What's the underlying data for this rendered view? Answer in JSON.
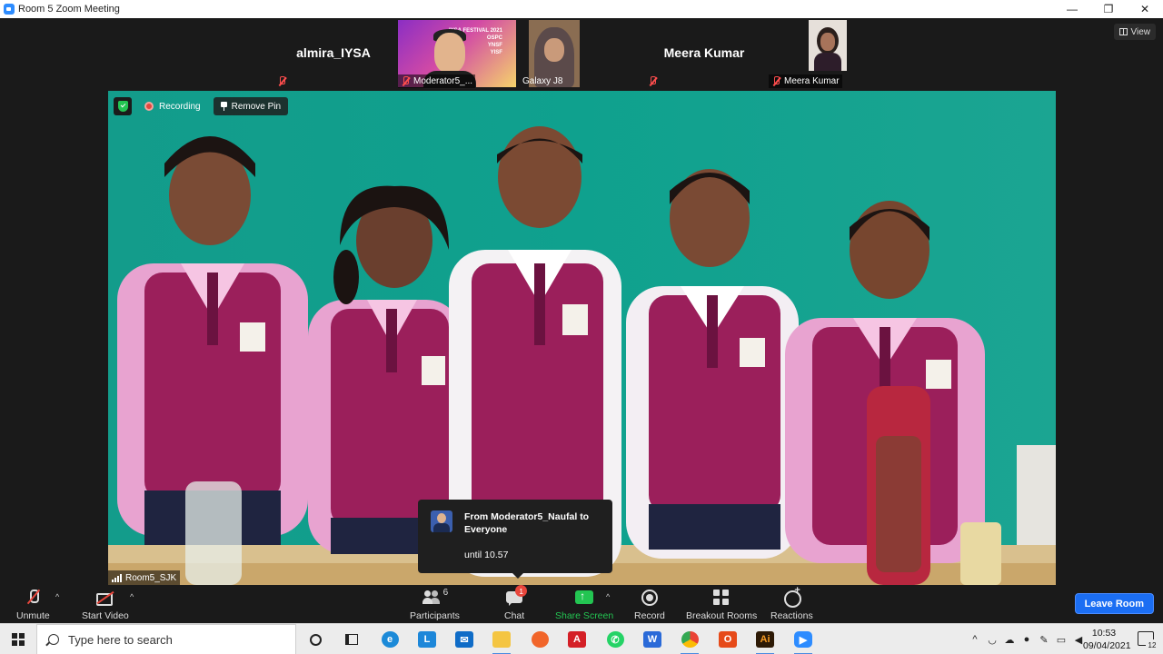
{
  "window": {
    "title": "Room 5   Zoom Meeting",
    "minimize": "—",
    "restore": "❐",
    "close": "✕"
  },
  "view_button": {
    "label": "View"
  },
  "thumbnails": [
    {
      "name": "almira_IYSA",
      "display": "name-only",
      "mic": "muted"
    },
    {
      "name": "Moderator5_...",
      "display": "video",
      "mic": "muted",
      "poster_text": "IYSA FESTIVAL 2021\nOSPC\nYNSF\nYISF"
    },
    {
      "name": "Galaxy J8",
      "display": "video",
      "mic": "on"
    },
    {
      "name": "Meera Kumar",
      "display": "name-only",
      "mic": "muted"
    },
    {
      "name": "Meera Kumar",
      "display": "video",
      "mic": "muted"
    }
  ],
  "main_video": {
    "recording_label": "Recording",
    "remove_pin_label": "Remove Pin",
    "participant_name": "Room5_SJK",
    "background_color": "#0f9d8c"
  },
  "chat_popup": {
    "from": "From Moderator5_Naufal to Everyone",
    "message": "until 10.57"
  },
  "toolbar": {
    "unmute": "Unmute",
    "start_video": "Start Video",
    "participants": "Participants",
    "participants_count": "6",
    "chat": "Chat",
    "chat_badge": "1",
    "share_screen": "Share Screen",
    "record": "Record",
    "breakout_rooms": "Breakout Rooms",
    "reactions": "Reactions",
    "leave_room": "Leave Room",
    "share_color": "#23c552",
    "leave_color": "#1b6ef3"
  },
  "taskbar": {
    "search_placeholder": "Type here to search",
    "apps": [
      "cortana-icon",
      "task-view-icon",
      "edge-icon",
      "l-app-icon",
      "mail-icon",
      "file-explorer-icon",
      "firefox-icon",
      "acrobat-icon",
      "whatsapp-icon",
      "wps-icon",
      "chrome-icon",
      "office-icon",
      "illustrator-icon",
      "zoom-icon"
    ],
    "time": "10:53",
    "date": "09/04/2021",
    "notification_count": "12"
  }
}
